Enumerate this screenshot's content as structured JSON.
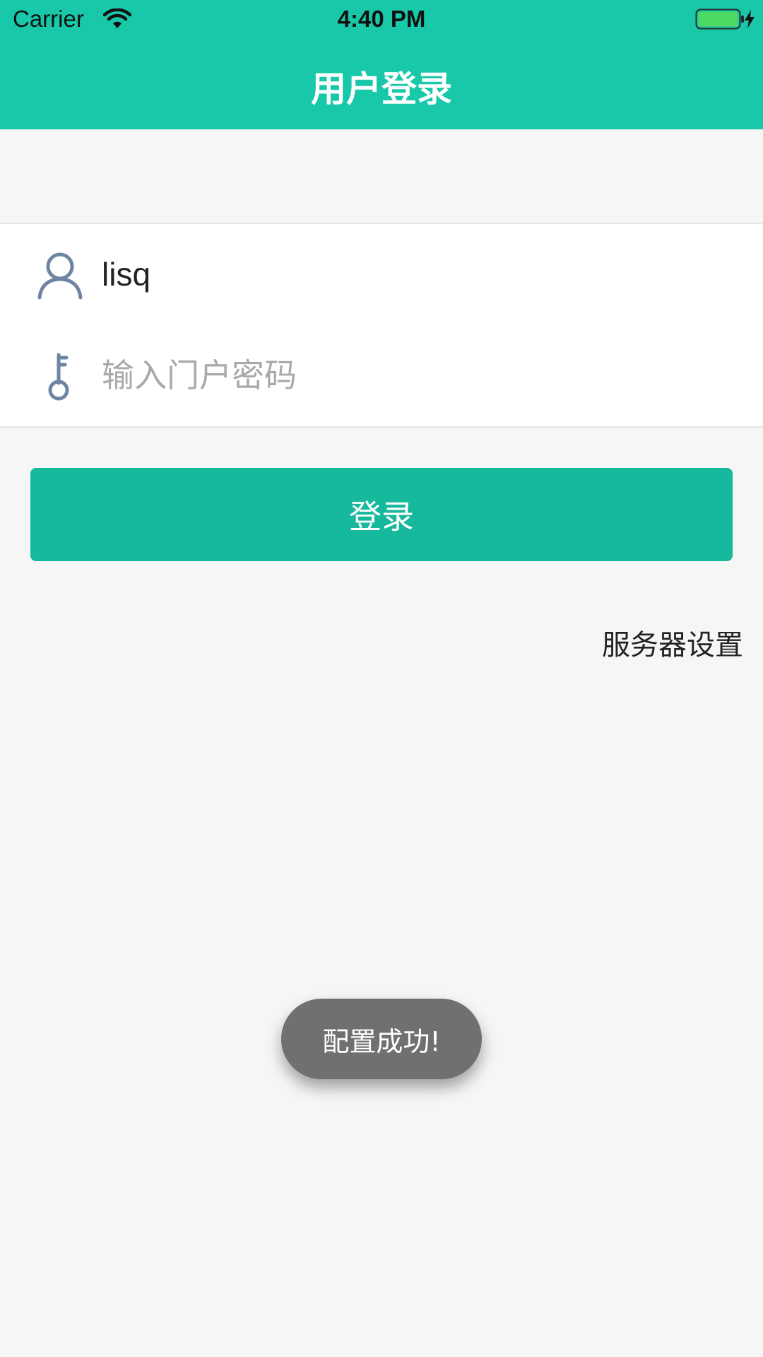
{
  "status_bar": {
    "carrier": "Carrier",
    "time": "4:40 PM"
  },
  "nav": {
    "title": "用户登录"
  },
  "form": {
    "username": {
      "value": "lisq",
      "icon": "user-icon"
    },
    "password": {
      "placeholder": "输入门户密码",
      "icon": "key-icon"
    },
    "login_label": "登录",
    "server_settings_label": "服务器设置"
  },
  "toast": {
    "message": "配置成功!"
  },
  "colors": {
    "header_bg": "#18c8a8",
    "button_bg": "#16b99b",
    "page_bg": "#f5f7f7",
    "icon_color": "#6e84a3",
    "toast_bg": "#6f716f"
  }
}
